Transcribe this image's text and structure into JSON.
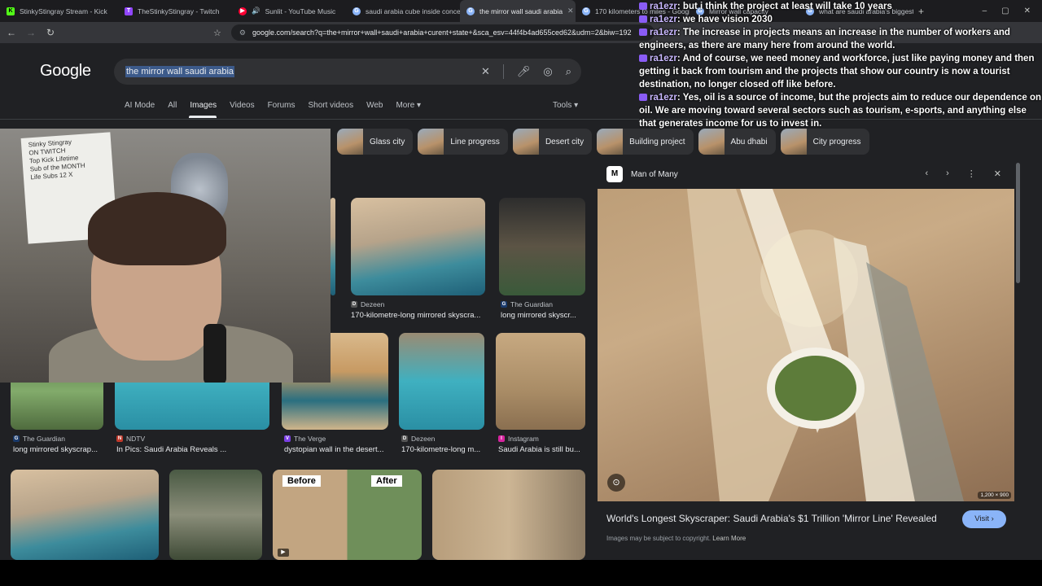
{
  "tabs": [
    {
      "label": "StinkyStingray Stream - Kick",
      "color": "#53fc18",
      "glyph": "K"
    },
    {
      "label": "TheStinkyStingray - Twitch",
      "color": "#9146ff",
      "glyph": "T"
    },
    {
      "label": "Sunlit - YouTube Music",
      "color": "#ff0033",
      "glyph": "▶"
    },
    {
      "label": "saudi arabia cube inside concept",
      "color": "#8ab4f8",
      "glyph": "G"
    },
    {
      "label": "the mirror wall saudi arabia",
      "color": "#8ab4f8",
      "glyph": "G",
      "active": true
    },
    {
      "label": "170 kilometers to miles - Google",
      "color": "#8ab4f8",
      "glyph": "G"
    },
    {
      "label": "Mirror wall capacity",
      "color": "#8ab4f8",
      "glyph": "G"
    },
    {
      "label": "what are saudi arabia's biggest",
      "color": "#8ab4f8",
      "glyph": "G"
    }
  ],
  "url": "google.com/search?q=the+mirror+wall+saudi+arabia+curent+state+&sca_esv=44f4b4ad655ced62&udm=2&biw=192",
  "google": {
    "logo": "Google",
    "query": "the mirror wall saudi arabia",
    "tabs": [
      "AI Mode",
      "All",
      "Images",
      "Videos",
      "Forums",
      "Short videos",
      "Web",
      "More ▾"
    ],
    "tools": "Tools ▾"
  },
  "chat": [
    {
      "user": "ra1ezr",
      "text": ": but i think the project at least will take 10 years"
    },
    {
      "user": "ra1ezr",
      "text": ": we have vision 2030"
    },
    {
      "user": "ra1ezr",
      "text": ": The increase in projects means an increase in the number of workers and engineers, as there are many here from around the world."
    },
    {
      "user": "ra1ezr",
      "text": ": And of course, we need money and workforce, just like paying money and then getting it back from tourism and the projects that show our country is now a tourist destination, no longer closed off like before."
    },
    {
      "user": "ra1ezr",
      "text": ": Yes, oil is a source of income, but the projects aim to reduce our dependence on oil. We are moving toward several sectors such as tourism, e-sports, and anything else that generates income for us to invest in."
    }
  ],
  "chips": [
    "Glass city",
    "Line progress",
    "Desert city",
    "Building project",
    "Abu dhabi",
    "City progress"
  ],
  "webcam": {
    "board_text": "Stinky Stingray\nON TWITCH\nTop Kick Lifetime\nSub of the MONTH\nLife Subs 12 X"
  },
  "results": {
    "row1": [
      {
        "source": "Dezeen",
        "caption": "170-kilometre-long mirrored skyscra...",
        "icon_color": "#555"
      },
      {
        "source": "The Guardian",
        "caption": "long mirrored skyscr...",
        "icon_color": "#1a3a6b"
      }
    ],
    "row2": [
      {
        "source": "The Guardian",
        "caption": "long mirrored skyscrap...",
        "icon_color": "#1a3a6b"
      },
      {
        "source": "NDTV",
        "caption": "In Pics: Saudi Arabia Reveals ...",
        "icon_color": "#c0392b"
      },
      {
        "source": "The Verge",
        "caption": "dystopian wall in the desert...",
        "icon_color": "#7b3fe4"
      },
      {
        "source": "Dezeen",
        "caption": "170-kilometre-long m...",
        "icon_color": "#555"
      },
      {
        "source": "Instagram",
        "caption": "Saudi Arabia is still bu...",
        "icon_color": "#d6249f"
      }
    ],
    "before_label": "Before",
    "after_label": "After"
  },
  "panel": {
    "source": "Man of Many",
    "logo": "M",
    "dims": "1,200 × 900",
    "title": "World's Longest Skyscraper: Saudi Arabia's $1 Trillion 'Mirror Line' Revealed",
    "visit": "Visit ›",
    "note": "Images may be subject to copyright.",
    "learn_more": "Learn More"
  }
}
